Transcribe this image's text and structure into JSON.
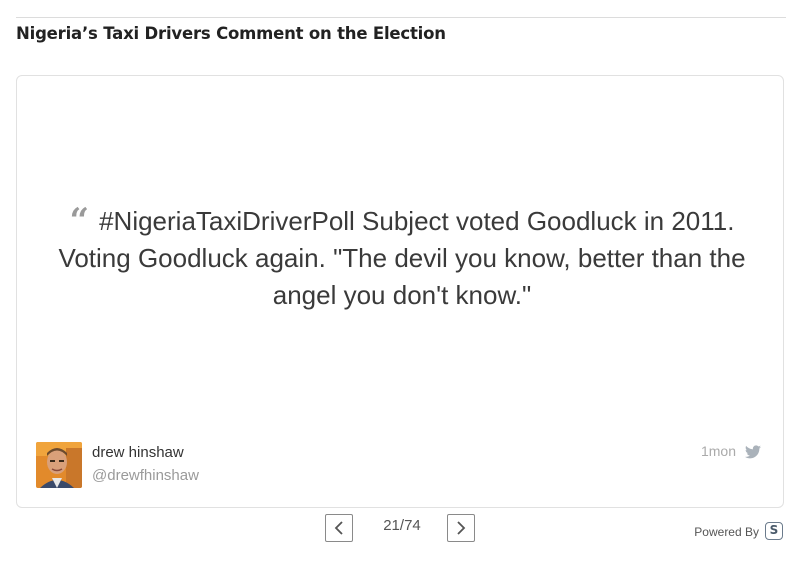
{
  "header": {
    "title": "Nigeria’s Taxi Drivers Comment on the Election"
  },
  "story": {
    "quote_mark": "“",
    "quote_text": "#NigeriaTaxiDriverPoll Subject voted Goodluck in 2011. Voting Goodluck again. \"The devil you know, better than the angel you don't know.\"",
    "author_name": "drew hinshaw",
    "author_handle": "@drewfhinshaw",
    "timestamp": "1mon",
    "source_icon": "twitter-bird-icon",
    "avatar_icon": "user-avatar-photo"
  },
  "pagination": {
    "current": "21/74",
    "prev_icon": "chevron-left-icon",
    "next_icon": "chevron-right-icon"
  },
  "footer": {
    "powered_by": "Powered By",
    "logo_letter": "S",
    "logo_icon": "storify-logo-icon"
  },
  "colors": {
    "text": "#3a3a3a",
    "muted": "#9a9a9a",
    "border": "#e1e1e1",
    "twitter": "#aab2ba"
  }
}
